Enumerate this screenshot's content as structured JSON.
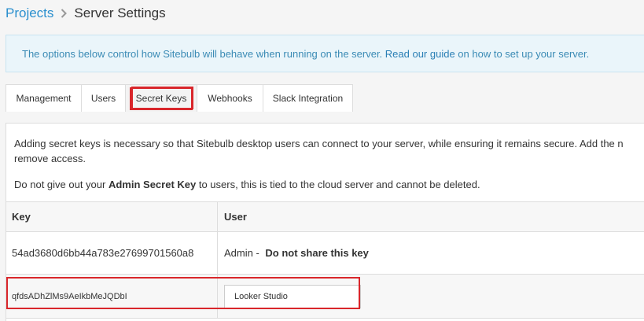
{
  "breadcrumb": {
    "projects": "Projects",
    "current": "Server Settings"
  },
  "banner": {
    "text_before": "The options below control how Sitebulb will behave when running on the server. ",
    "link": "Read our guide",
    "text_after": " on how to set up your server."
  },
  "tabs": [
    {
      "label": "Management"
    },
    {
      "label": "Users"
    },
    {
      "label": "Secret Keys",
      "active": true
    },
    {
      "label": "Webhooks"
    },
    {
      "label": "Slack Integration"
    }
  ],
  "panel": {
    "desc_line1": "Adding secret keys is necessary so that Sitebulb desktop users can connect to your server, while ensuring it remains secure. Add the n",
    "desc_line2": "remove access.",
    "warn_before": "Do not give out your ",
    "warn_bold": "Admin Secret Key",
    "warn_after": " to users, this is tied to the cloud server and cannot be deleted."
  },
  "table": {
    "headers": {
      "key": "Key",
      "user": "User"
    },
    "rows": [
      {
        "key": "54ad3680d6bb44a783e27699701560a8",
        "user_prefix": "Admin - ",
        "user_bold": "Do not share this key"
      },
      {
        "key": "qfdsADhZlMs9AeIkbMeJQDbI",
        "user_value": "Looker Studio"
      }
    ]
  },
  "colors": {
    "link": "#2a8fce",
    "annotation": "#d9262b",
    "banner_bg": "#eaf5fa"
  }
}
